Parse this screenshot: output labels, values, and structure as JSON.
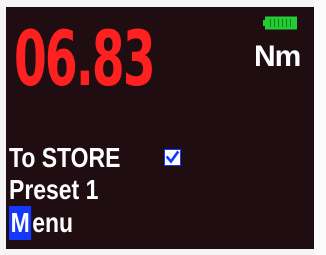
{
  "display": {
    "reading": "06.83",
    "unit": "Nm",
    "battery": {
      "level": 1.0,
      "color": "#22cc33"
    },
    "store_label": "To STORE",
    "store_checked": true,
    "preset_label": "Preset 1",
    "menu_hotkey": "M",
    "menu_rest": "enu"
  },
  "colors": {
    "reading": "#ff2020",
    "screen_bg": "#1f0d12",
    "text": "#ffffff",
    "accent": "#1538ff"
  }
}
